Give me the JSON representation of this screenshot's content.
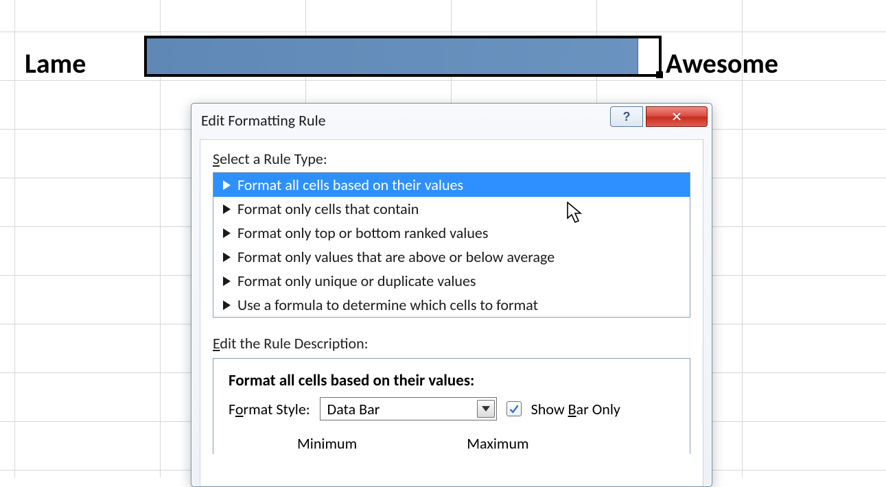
{
  "sheet": {
    "left_label": "Lame",
    "right_label": "Awesome",
    "databar_pct": 96
  },
  "dialog": {
    "title": "Edit Formatting Rule",
    "select_label_prefix": "S",
    "select_label_rest": "elect a Rule Type:",
    "rules": [
      {
        "label": "Format all cells based on their values",
        "selected": true
      },
      {
        "label": "Format only cells that contain",
        "selected": false
      },
      {
        "label": "Format only top or bottom ranked values",
        "selected": false
      },
      {
        "label": "Format only values that are above or below average",
        "selected": false
      },
      {
        "label": "Format only unique or duplicate values",
        "selected": false
      },
      {
        "label": "Use a formula to determine which cells to format",
        "selected": false
      }
    ],
    "edit_desc_prefix": "E",
    "edit_desc_rest": "dit the Rule Description:",
    "desc_heading": "Format all cells based on their values:",
    "format_style_label_prefix": "F",
    "format_style_label_u": "o",
    "format_style_label_rest": "rmat Style:",
    "format_style_value": "Data Bar",
    "show_bar_prefix": "Show ",
    "show_bar_u": "B",
    "show_bar_rest": "ar Only",
    "show_bar_checked": true,
    "min_label": "Minimum",
    "max_label": "Maximum"
  }
}
